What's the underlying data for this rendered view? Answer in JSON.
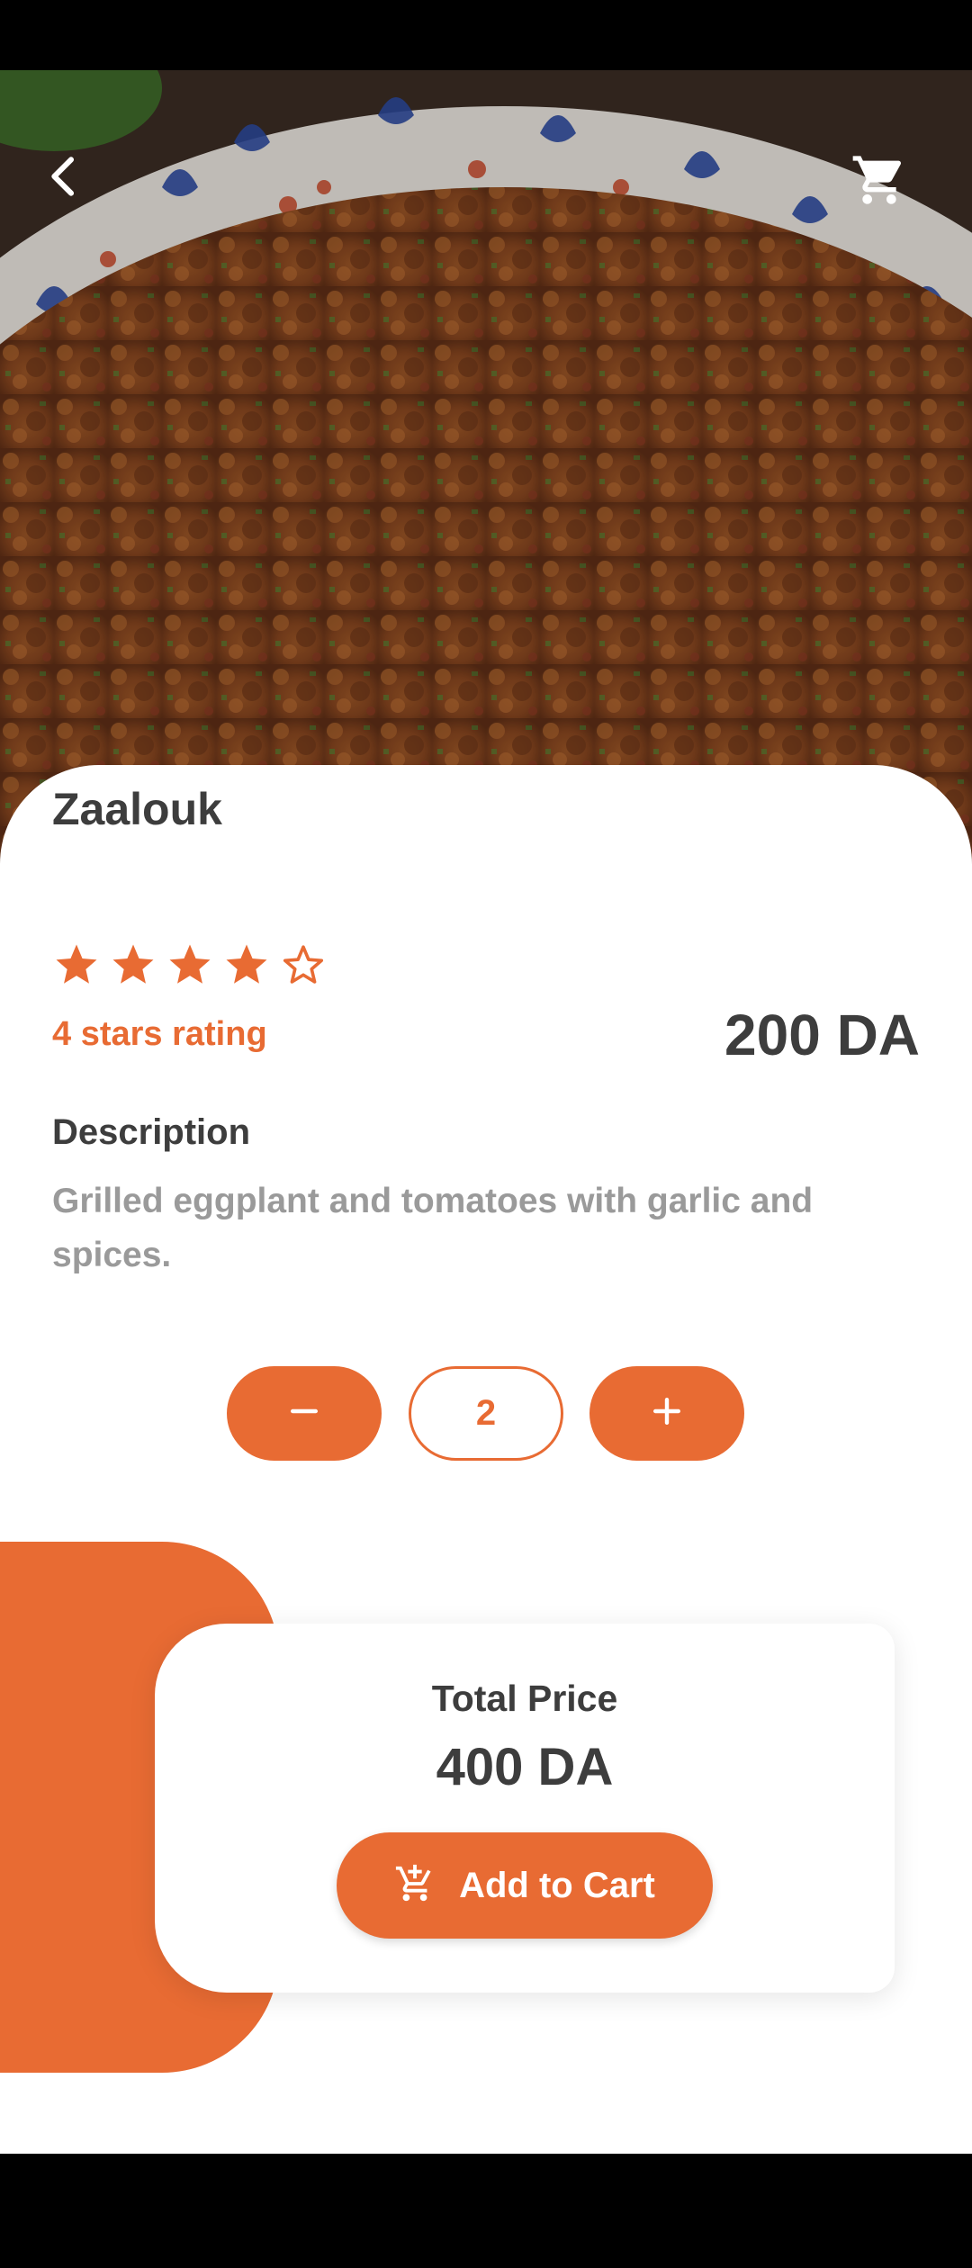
{
  "product": {
    "name": "Zaalouk",
    "rating": 4,
    "rating_max": 5,
    "rating_text": "4 stars rating",
    "price": "200 DA",
    "description_title": "Description",
    "description": "Grilled eggplant and tomatoes with garlic and spices."
  },
  "quantity": {
    "value": "2",
    "decrement_icon": "minus-icon",
    "increment_icon": "plus-icon"
  },
  "total": {
    "label": "Total Price",
    "value": "400 DA"
  },
  "cart_button": {
    "label": "Add to Cart",
    "icon": "add-shopping-cart-icon"
  },
  "header": {
    "back_icon": "chevron-left-icon",
    "cart_icon": "shopping-cart-icon"
  },
  "colors": {
    "accent": "#e86b33",
    "text_dark": "#3d3d3d",
    "text_muted": "#9a9a9a"
  }
}
